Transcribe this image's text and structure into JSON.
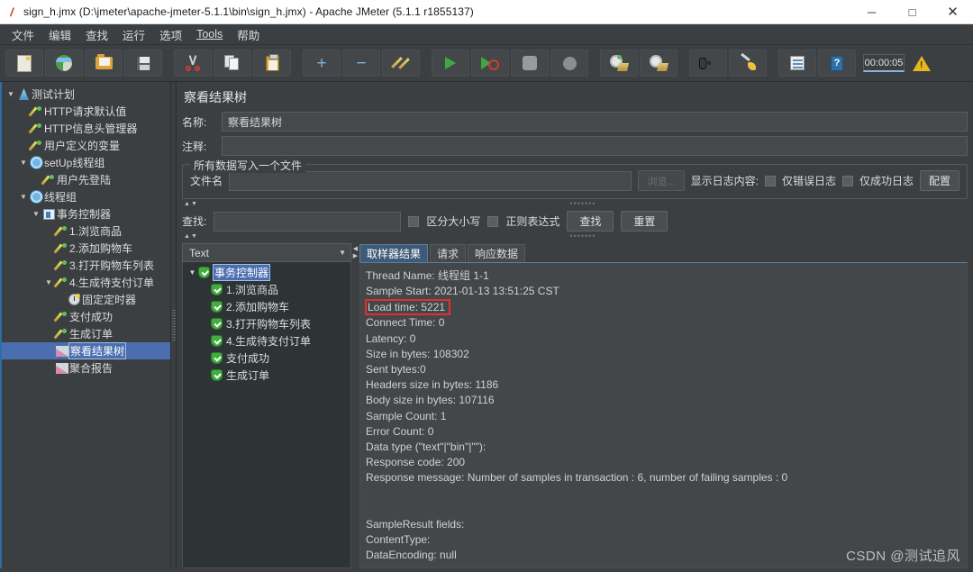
{
  "window": {
    "title": "sign_h.jmx (D:\\jmeter\\apache-jmeter-5.1.1\\bin\\sign_h.jmx) - Apache JMeter (5.1.1 r1855137)",
    "app_icon": "jmeter-feather-icon",
    "minimize": "─",
    "maximize": "□",
    "close": "✕"
  },
  "menu": [
    {
      "label": "文件",
      "name": "menu-file"
    },
    {
      "label": "编辑",
      "name": "menu-edit"
    },
    {
      "label": "查找",
      "name": "menu-search"
    },
    {
      "label": "运行",
      "name": "menu-run"
    },
    {
      "label": "选项",
      "name": "menu-options"
    },
    {
      "label": "Tools",
      "name": "menu-tools"
    },
    {
      "label": "帮助",
      "name": "menu-help"
    }
  ],
  "toolbar": {
    "buttons": [
      {
        "icon": "new-document-icon",
        "name": "toolbar-new"
      },
      {
        "icon": "templates-globe-icon",
        "name": "toolbar-templates"
      },
      {
        "icon": "open-folder-icon",
        "name": "toolbar-open"
      },
      {
        "icon": "save-floppy-icon",
        "name": "toolbar-save"
      },
      {
        "icon": "cut-scissors-icon",
        "name": "toolbar-cut"
      },
      {
        "icon": "copy-icon",
        "name": "toolbar-copy"
      },
      {
        "icon": "paste-clipboard-icon",
        "name": "toolbar-paste"
      },
      {
        "icon": "plus-icon",
        "name": "toolbar-expand-all"
      },
      {
        "icon": "minus-icon",
        "name": "toolbar-collapse-all"
      },
      {
        "icon": "toggle-pencils-icon",
        "name": "toolbar-toggle"
      },
      {
        "icon": "start-play-icon",
        "name": "toolbar-start"
      },
      {
        "icon": "start-no-pauses-icon",
        "name": "toolbar-start-no-pauses"
      },
      {
        "icon": "stop-icon",
        "name": "toolbar-stop"
      },
      {
        "icon": "shutdown-icon",
        "name": "toolbar-shutdown"
      },
      {
        "icon": "clear-gear-icon",
        "name": "toolbar-clear"
      },
      {
        "icon": "clear-all-gear-icon",
        "name": "toolbar-clear-all"
      },
      {
        "icon": "search-binoculars-icon",
        "name": "toolbar-search"
      },
      {
        "icon": "reset-search-broom-icon",
        "name": "toolbar-reset-search"
      },
      {
        "icon": "function-helper-icon",
        "name": "toolbar-function-helper"
      },
      {
        "icon": "help-book-icon",
        "name": "toolbar-help"
      }
    ],
    "plus_glyph": "+",
    "minus_glyph": "−",
    "help_glyph": "?",
    "timer": "00:00:05",
    "warning_icon": "warning-triangle-icon"
  },
  "tree": {
    "nodes": [
      {
        "label": "测试计划",
        "indent": 0,
        "twist": "▼",
        "icon": "test-plan-icon",
        "name": "tree-node-test-plan",
        "selected": false
      },
      {
        "label": "HTTP请求默认值",
        "indent": 1,
        "twist": "",
        "icon": "config-pencil-icon",
        "name": "tree-node-http-defaults",
        "selected": false
      },
      {
        "label": "HTTP信息头管理器",
        "indent": 1,
        "twist": "",
        "icon": "config-pencil-icon",
        "name": "tree-node-http-header-manager",
        "selected": false
      },
      {
        "label": "用户定义的变量",
        "indent": 1,
        "twist": "",
        "icon": "config-pencil-icon",
        "name": "tree-node-user-defined-variables",
        "selected": false
      },
      {
        "label": "setUp线程组",
        "indent": 1,
        "twist": "▼",
        "icon": "thread-group-gear-icon",
        "name": "tree-node-setup-thread-group",
        "selected": false
      },
      {
        "label": "用户先登陆",
        "indent": 2,
        "twist": "",
        "icon": "sampler-pencil-icon",
        "name": "tree-node-user-login",
        "selected": false
      },
      {
        "label": "线程组",
        "indent": 1,
        "twist": "▼",
        "icon": "thread-group-gear-icon",
        "name": "tree-node-thread-group",
        "selected": false
      },
      {
        "label": "事务控制器",
        "indent": 2,
        "twist": "▼",
        "icon": "transaction-controller-icon",
        "name": "tree-node-transaction-controller",
        "selected": false
      },
      {
        "label": "1.浏览商品",
        "indent": 3,
        "twist": "",
        "icon": "sampler-pencil-icon",
        "name": "tree-node-browse-products",
        "selected": false
      },
      {
        "label": "2.添加购物车",
        "indent": 3,
        "twist": "",
        "icon": "sampler-pencil-icon",
        "name": "tree-node-add-to-cart",
        "selected": false
      },
      {
        "label": "3.打开购物车列表",
        "indent": 3,
        "twist": "",
        "icon": "sampler-pencil-icon",
        "name": "tree-node-open-cart-list",
        "selected": false
      },
      {
        "label": "4.生成待支付订单",
        "indent": 3,
        "twist": "▼",
        "icon": "sampler-pencil-icon",
        "name": "tree-node-create-pending-order",
        "selected": false
      },
      {
        "label": "固定定时器",
        "indent": 4,
        "twist": "",
        "icon": "constant-timer-icon",
        "name": "tree-node-constant-timer",
        "selected": false
      },
      {
        "label": "支付成功",
        "indent": 3,
        "twist": "",
        "icon": "sampler-pencil-icon",
        "name": "tree-node-payment-success",
        "selected": false
      },
      {
        "label": "生成订单",
        "indent": 3,
        "twist": "",
        "icon": "sampler-pencil-icon",
        "name": "tree-node-create-order",
        "selected": false
      },
      {
        "label": "察看结果树",
        "indent": 3,
        "twist": "",
        "icon": "view-results-tree-icon",
        "name": "tree-node-view-results-tree",
        "selected": true
      },
      {
        "label": "聚合报告",
        "indent": 3,
        "twist": "",
        "icon": "aggregate-report-icon",
        "name": "tree-node-aggregate-report",
        "selected": false
      }
    ]
  },
  "panel": {
    "title": "察看结果树",
    "name_label": "名称:",
    "name_value": "察看结果树",
    "comment_label": "注释:",
    "comment_value": "",
    "filegroup": {
      "title": "所有数据写入一个文件",
      "filename_label": "文件名",
      "filename_value": "",
      "browse_button": "浏览...",
      "log_content_label": "显示日志内容:",
      "errors_only": "仅错误日志",
      "success_only": "仅成功日志",
      "configure_button": "配置"
    },
    "search": {
      "label": "查找:",
      "value": "",
      "case_sensitive": "区分大小写",
      "regex": "正则表达式",
      "find_button": "查找",
      "reset_button": "重置"
    }
  },
  "results": {
    "renderer": "Text",
    "renderer_arrow": "▼",
    "tree": [
      {
        "label": "事务控制器",
        "twist": "▼",
        "indent": 0,
        "selected": true,
        "name": "result-node-transaction-controller"
      },
      {
        "label": "1.浏览商品",
        "twist": "",
        "indent": 1,
        "selected": false,
        "name": "result-node-browse-products"
      },
      {
        "label": "2.添加购物车",
        "twist": "",
        "indent": 1,
        "selected": false,
        "name": "result-node-add-to-cart"
      },
      {
        "label": "3.打开购物车列表",
        "twist": "",
        "indent": 1,
        "selected": false,
        "name": "result-node-open-cart-list"
      },
      {
        "label": "4.生成待支付订单",
        "twist": "",
        "indent": 1,
        "selected": false,
        "name": "result-node-create-pending-order"
      },
      {
        "label": "支付成功",
        "twist": "",
        "indent": 1,
        "selected": false,
        "name": "result-node-payment-success"
      },
      {
        "label": "生成订单",
        "twist": "",
        "indent": 1,
        "selected": false,
        "name": "result-node-create-order"
      }
    ],
    "tabs": [
      {
        "label": "取样器结果",
        "active": true,
        "name": "tab-sampler-result"
      },
      {
        "label": "请求",
        "active": false,
        "name": "tab-request"
      },
      {
        "label": "响应数据",
        "active": false,
        "name": "tab-response-data"
      }
    ],
    "detail_lines": [
      {
        "text": "Thread Name: 线程组 1-1",
        "highlight": false
      },
      {
        "text": "Sample Start: 2021-01-13 13:51:25 CST",
        "highlight": false
      },
      {
        "text": "Load time: 5221",
        "highlight": true
      },
      {
        "text": "Connect Time: 0",
        "highlight": false
      },
      {
        "text": "Latency: 0",
        "highlight": false
      },
      {
        "text": "Size in bytes: 108302",
        "highlight": false
      },
      {
        "text": "Sent bytes:0",
        "highlight": false
      },
      {
        "text": "Headers size in bytes: 1186",
        "highlight": false
      },
      {
        "text": "Body size in bytes: 107116",
        "highlight": false
      },
      {
        "text": "Sample Count: 1",
        "highlight": false
      },
      {
        "text": "Error Count: 0",
        "highlight": false
      },
      {
        "text": "Data type (\"text\"|\"bin\"|\"\"):",
        "highlight": false
      },
      {
        "text": "Response code: 200",
        "highlight": false
      },
      {
        "text": "Response message: Number of samples in transaction : 6, number of failing samples : 0",
        "highlight": false
      },
      {
        "text": "",
        "highlight": false
      },
      {
        "text": "",
        "highlight": false
      },
      {
        "text": "SampleResult fields:",
        "highlight": false
      },
      {
        "text": "ContentType:",
        "highlight": false
      },
      {
        "text": "DataEncoding: null",
        "highlight": false
      }
    ],
    "highlight_color": "#e03030"
  },
  "watermark": "CSDN @测试追风"
}
